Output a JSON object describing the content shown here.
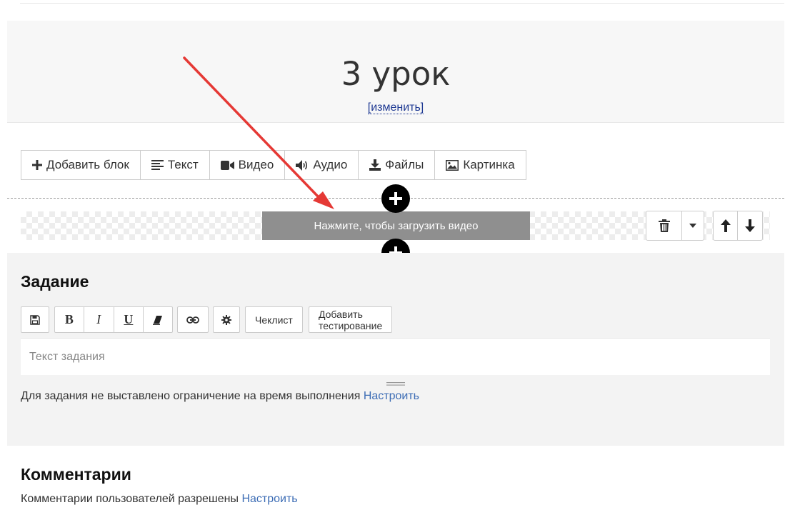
{
  "lesson": {
    "title": "3 урок",
    "edit_link": "[изменить]"
  },
  "block_toolbar": {
    "items": [
      {
        "label": "Добавить блок",
        "icon": "plus-icon"
      },
      {
        "label": "Текст",
        "icon": "text-lines-icon"
      },
      {
        "label": "Видео",
        "icon": "video-camera-icon"
      },
      {
        "label": "Аудио",
        "icon": "speaker-icon"
      },
      {
        "label": "Файлы",
        "icon": "download-icon"
      },
      {
        "label": "Картинка",
        "icon": "image-icon"
      }
    ]
  },
  "video_block": {
    "upload_label": "Нажмите, чтобы загрузить видео",
    "controls": [
      "trash-icon",
      "caret-down-icon",
      "arrow-up-icon",
      "arrow-down-icon"
    ]
  },
  "task": {
    "heading": "Задание",
    "toolbar": {
      "bold": "B",
      "italic": "I",
      "underline": "U",
      "checklist": "Чеклист",
      "add_test": "Добавить тестирование"
    },
    "placeholder": "Текст задания",
    "time_limit_text": "Для задания не выставлено ограничение на время выполнения",
    "configure_link": "Настроить"
  },
  "comments": {
    "heading": "Комментарии",
    "status_text": "Комментарии пользователей разрешены",
    "configure_link": "Настроить"
  },
  "colors": {
    "annotation_arrow": "#e53935",
    "link": "#3d6db5",
    "upload_button": "#8f8f8f"
  }
}
